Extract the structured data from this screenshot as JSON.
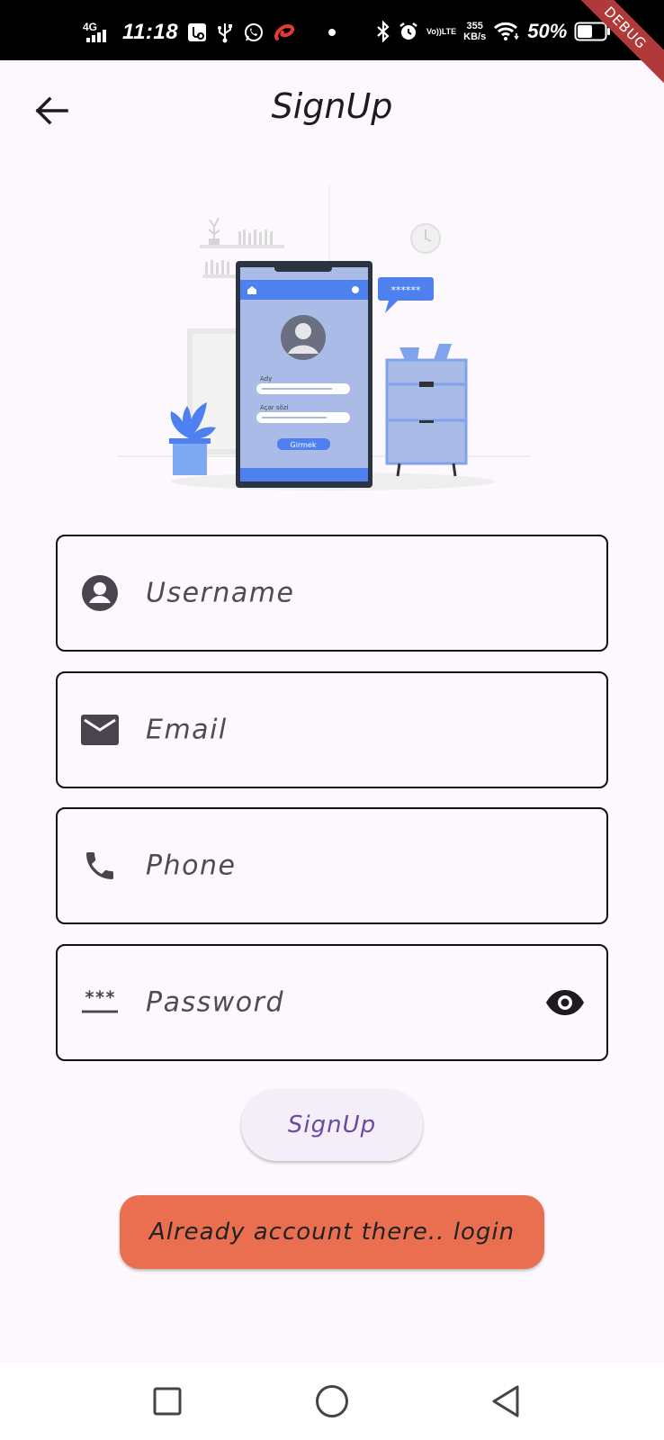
{
  "status_bar": {
    "network": "4G",
    "time": "11:18",
    "volte_top": "Vo))",
    "volte_bottom": "LTE",
    "speed_value": "355",
    "speed_unit": "KB/s",
    "battery_percent": "50%",
    "icons": [
      "signal-icon",
      "usb-debug-icon",
      "usb-icon",
      "whatsapp-icon",
      "airtel-icon",
      "dot-icon",
      "bluetooth-icon",
      "alarm-icon",
      "volte-icon",
      "wifi-icon",
      "battery-icon"
    ]
  },
  "debug_banner": "DEBUG",
  "app_bar": {
    "back_icon": "arrow-back-icon",
    "title": "SignUp"
  },
  "illustration": {
    "name": "signup-phone-illustration",
    "phone_field_1_label": "Ady",
    "phone_field_2_label": "Açar sözi",
    "phone_button_label": "Girmek",
    "bubble_text": "******",
    "colors": {
      "primary": "#4f80f0",
      "light": "#a9bbe6",
      "frame": "#2b3440"
    }
  },
  "form": {
    "username": {
      "placeholder": "Username",
      "icon": "account-circle-icon"
    },
    "email": {
      "placeholder": "Email",
      "icon": "email-icon"
    },
    "phone": {
      "placeholder": "Phone",
      "icon": "phone-icon"
    },
    "password": {
      "placeholder": "Password",
      "icon": "password-icon",
      "prefix_glyph": "***",
      "toggle_icon": "eye-icon"
    }
  },
  "buttons": {
    "signup_label": "SignUp",
    "login_label": "Already account there.. login"
  },
  "nav_bar": {
    "icons": [
      "recent-apps-icon",
      "home-icon",
      "back-icon"
    ]
  },
  "colors": {
    "background": "#fdf8fd",
    "login_button": "#e96f50",
    "signup_text": "#6a4aa0",
    "field_border": "#111111"
  }
}
